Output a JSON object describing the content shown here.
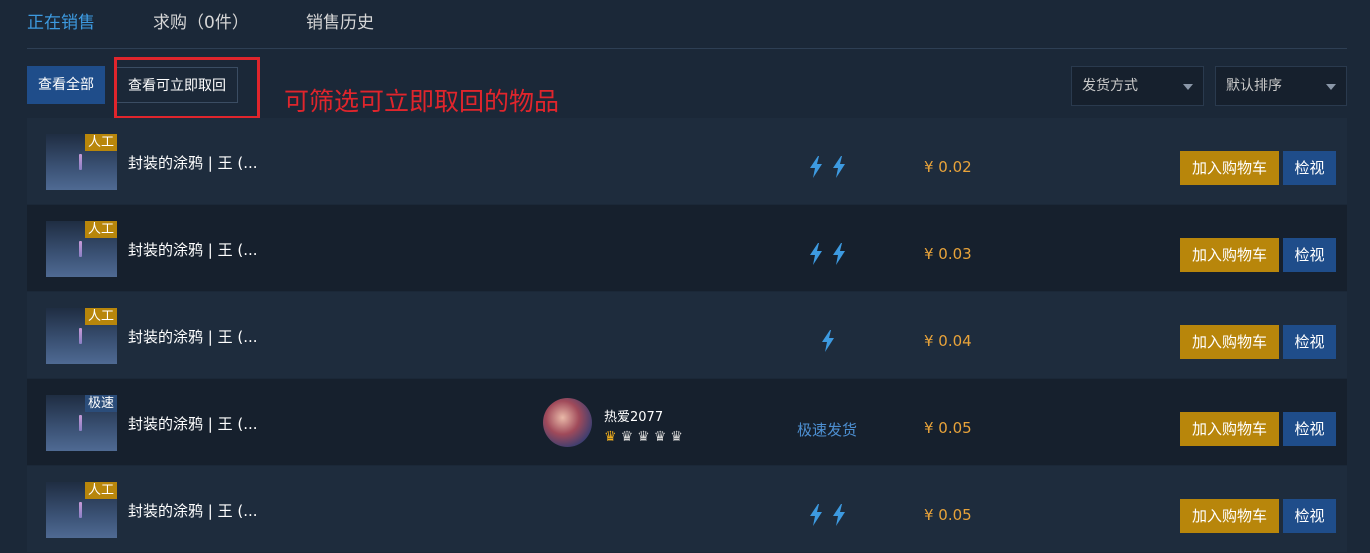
{
  "tabs": [
    {
      "label": "正在销售",
      "active": true
    },
    {
      "label": "求购（0件）",
      "active": false
    },
    {
      "label": "销售历史",
      "active": false
    }
  ],
  "filters": {
    "view_all": "查看全部",
    "view_instant": "查看可立即取回"
  },
  "annotation": "可筛选可立即取回的物品",
  "selects": {
    "shipping": "发货方式",
    "sort": "默认排序"
  },
  "colors": {
    "accent_blue": "#1f4d8a",
    "cart_gold": "#b8860b",
    "price_orange": "#e8a33a",
    "highlight_red": "#e0252c",
    "tab_active": "#3d9ae0"
  },
  "listings": [
    {
      "tag": "人工",
      "tag_type": "manual",
      "name": "封装的涂鸦 | 王 (...",
      "bolts": 2,
      "price": "¥ 0.02",
      "cart_label": "加入购物车",
      "inspect_label": "检视"
    },
    {
      "tag": "人工",
      "tag_type": "manual",
      "name": "封装的涂鸦 | 王 (...",
      "bolts": 2,
      "price": "¥ 0.03",
      "cart_label": "加入购物车",
      "inspect_label": "检视"
    },
    {
      "tag": "人工",
      "tag_type": "manual",
      "name": "封装的涂鸦 | 王 (...",
      "bolts": 1,
      "price": "¥ 0.04",
      "cart_label": "加入购物车",
      "inspect_label": "检视"
    },
    {
      "tag": "极速",
      "tag_type": "fast",
      "name": "封装的涂鸦 | 王 (...",
      "bolts": 0,
      "seller": {
        "name": "热爱2077",
        "badges": "gold-crown, 4x gray-crown"
      },
      "shipping_text": "极速发货",
      "price": "¥ 0.05",
      "cart_label": "加入购物车",
      "inspect_label": "检视"
    },
    {
      "tag": "人工",
      "tag_type": "manual",
      "name": "封装的涂鸦 | 王 (...",
      "bolts": 2,
      "price": "¥ 0.05",
      "cart_label": "加入购物车",
      "inspect_label": "检视"
    }
  ]
}
